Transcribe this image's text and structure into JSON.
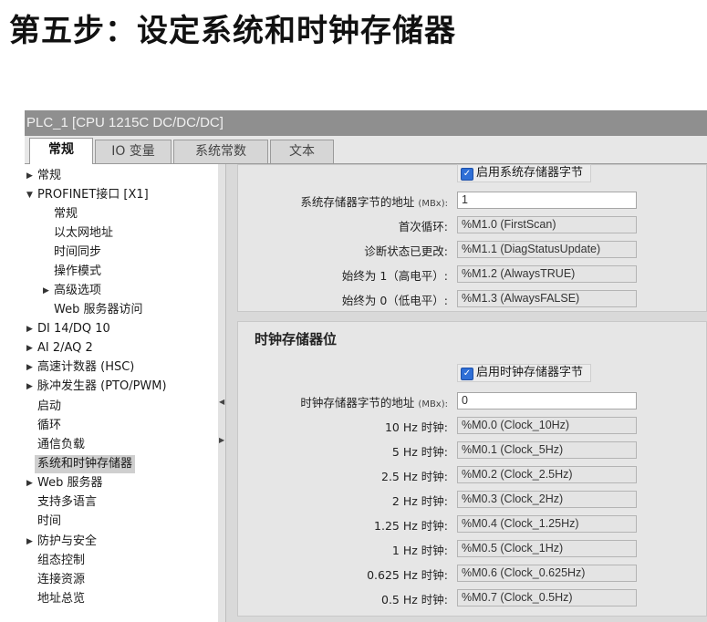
{
  "slide_title": "第五步：设定系统和时钟存储器",
  "window": {
    "title": "PLC_1 [CPU 1215C DC/DC/DC]",
    "tabs": [
      "常规",
      "IO 变量",
      "系统常数",
      "文本"
    ],
    "active_tab": "常规"
  },
  "tree": [
    {
      "label": "常规",
      "arrow": "▶"
    },
    {
      "label": "PROFINET接口 [X1]",
      "arrow": "▼"
    },
    {
      "label": "常规",
      "arrow": ""
    },
    {
      "label": "以太网地址",
      "arrow": ""
    },
    {
      "label": "时间同步",
      "arrow": ""
    },
    {
      "label": "操作模式",
      "arrow": ""
    },
    {
      "label": "高级选项",
      "arrow": "▶"
    },
    {
      "label": "Web 服务器访问",
      "arrow": ""
    },
    {
      "label": "DI 14/DQ 10",
      "arrow": "▶"
    },
    {
      "label": "AI 2/AQ 2",
      "arrow": "▶"
    },
    {
      "label": "高速计数器 (HSC)",
      "arrow": "▶"
    },
    {
      "label": "脉冲发生器 (PTO/PWM)",
      "arrow": "▶"
    },
    {
      "label": "启动",
      "arrow": ""
    },
    {
      "label": "循环",
      "arrow": ""
    },
    {
      "label": "通信负载",
      "arrow": ""
    },
    {
      "label": "系统和时钟存储器",
      "arrow": ""
    },
    {
      "label": "Web 服务器",
      "arrow": "▶"
    },
    {
      "label": "支持多语言",
      "arrow": ""
    },
    {
      "label": "时间",
      "arrow": ""
    },
    {
      "label": "防护与安全",
      "arrow": "▶"
    },
    {
      "label": "组态控制",
      "arrow": ""
    },
    {
      "label": "连接资源",
      "arrow": ""
    },
    {
      "label": "地址总览",
      "arrow": ""
    }
  ],
  "system_memory": {
    "enable_label": "启用系统存储器字节",
    "enabled": true,
    "address_label": "系统存储器字节的地址",
    "address_unit": "(MBx):",
    "address_value": "1",
    "rows": [
      {
        "label": "首次循环:",
        "value": "%M1.0 (FirstScan)"
      },
      {
        "label": "诊断状态已更改:",
        "value": "%M1.1 (DiagStatusUpdate)"
      },
      {
        "label": "始终为 1（高电平）:",
        "value": "%M1.2 (AlwaysTRUE)"
      },
      {
        "label": "始终为 0（低电平）:",
        "value": "%M1.3 (AlwaysFALSE)"
      }
    ]
  },
  "clock_memory": {
    "section_title": "时钟存储器位",
    "enable_label": "启用时钟存储器字节",
    "enabled": true,
    "address_label": "时钟存储器字节的地址",
    "address_unit": "(MBx):",
    "address_value": "0",
    "rows": [
      {
        "label": "10 Hz 时钟:",
        "value": "%M0.0 (Clock_10Hz)"
      },
      {
        "label": "5 Hz 时钟:",
        "value": "%M0.1 (Clock_5Hz)"
      },
      {
        "label": "2.5 Hz 时钟:",
        "value": "%M0.2 (Clock_2.5Hz)"
      },
      {
        "label": "2 Hz 时钟:",
        "value": "%M0.3 (Clock_2Hz)"
      },
      {
        "label": "1.25 Hz 时钟:",
        "value": "%M0.4 (Clock_1.25Hz)"
      },
      {
        "label": "1 Hz 时钟:",
        "value": "%M0.5 (Clock_1Hz)"
      },
      {
        "label": "0.625 Hz 时钟:",
        "value": "%M0.6 (Clock_0.625Hz)"
      },
      {
        "label": "0.5 Hz 时钟:",
        "value": "%M0.7 (Clock_0.5Hz)"
      }
    ]
  },
  "colors": {
    "checkbox": "#2f6fd6",
    "titlebar": "#8f8f8f",
    "selected": "#cfcfcf"
  }
}
